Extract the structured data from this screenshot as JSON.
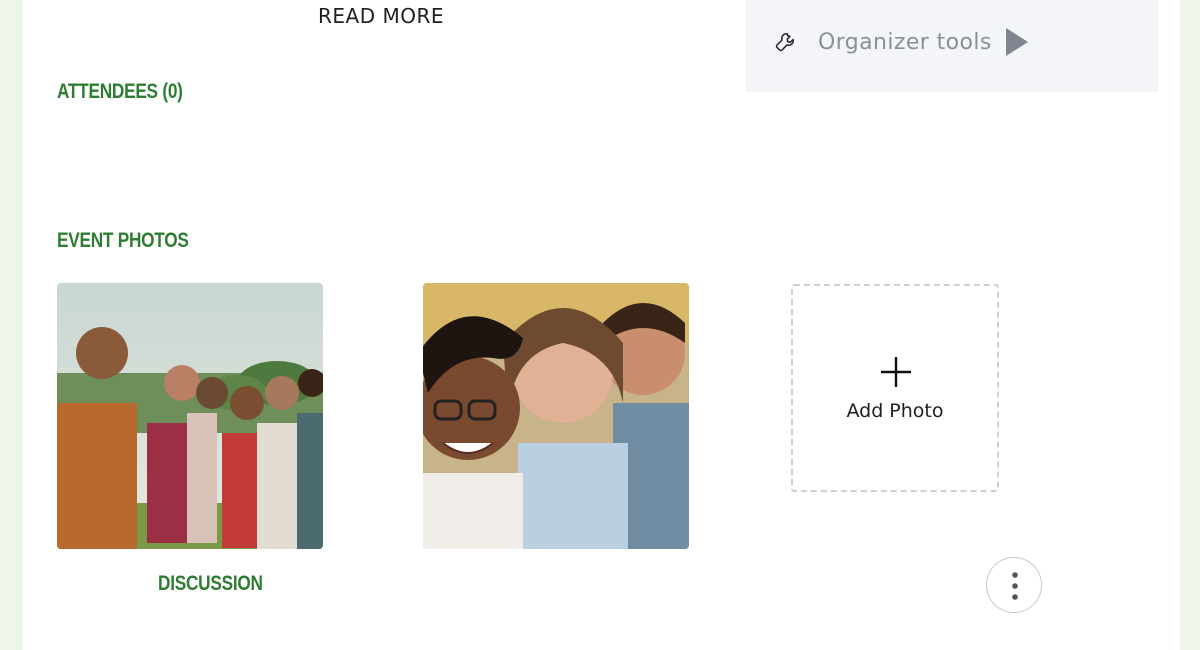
{
  "read_more": {
    "label": "READ MORE"
  },
  "organizer": {
    "label": "Organizer tools",
    "icon": "wrench-icon",
    "arrow_icon": "play-triangle-icon"
  },
  "attendees": {
    "heading": "ATTENDEES (0)"
  },
  "event_photos": {
    "heading": "EVENT PHOTOS",
    "photos": [
      {
        "alt": "Group of friends hugging outdoors"
      },
      {
        "alt": "Close-up of smiling friends"
      }
    ],
    "add_photo": {
      "label": "Add Photo",
      "icon": "plus-icon"
    }
  },
  "discussion": {
    "heading": "DISCUSSION"
  },
  "more_menu": {
    "icon": "kebab-menu-icon"
  },
  "colors": {
    "heading_green": "#2e7d32",
    "panel_bg": "#f4f5f8",
    "muted_text": "#8a9099",
    "page_bg": "#eef6ec"
  }
}
